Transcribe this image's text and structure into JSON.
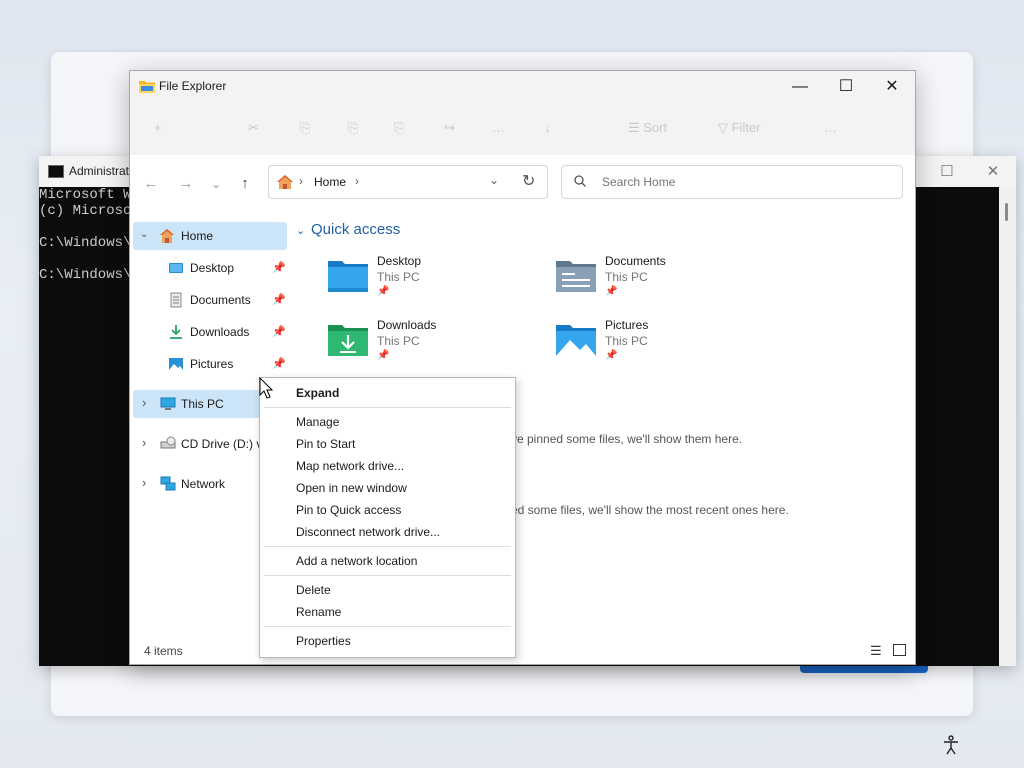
{
  "cmd": {
    "title": "Administrat",
    "lines": [
      "Microsoft Wi",
      "(c) Microso",
      "",
      "C:\\Windows\\S",
      "",
      "C:\\Windows\\S"
    ]
  },
  "explorer": {
    "title": "File Explorer",
    "controls": {
      "minimize": "—",
      "maximize": "☐",
      "close": "✕"
    },
    "toolbar_ghost": [
      "+",
      "✂",
      "⎘",
      "⎘",
      "⎘",
      "↪",
      "…",
      "↓",
      "☰ Sort",
      "▽ Filter",
      "…"
    ],
    "nav": {
      "back": "←",
      "forward": "→",
      "recent": "⌄",
      "up": "↑"
    },
    "address": {
      "path": "Home",
      "separator": "›",
      "dropdown": "⌄",
      "refresh": "↻"
    },
    "search": {
      "placeholder": "Search Home"
    },
    "sidebar": {
      "items": [
        {
          "label": "Home",
          "chevron": "⌄",
          "selected": true
        },
        {
          "label": "Desktop",
          "pinned": true
        },
        {
          "label": "Documents",
          "pinned": true
        },
        {
          "label": "Downloads",
          "pinned": true
        },
        {
          "label": "Pictures",
          "pinned": true
        },
        {
          "label": "This PC",
          "chevron": "›",
          "selected": true
        },
        {
          "label": "CD Drive (D:) v",
          "chevron": "›"
        },
        {
          "label": "Network",
          "chevron": "›"
        }
      ]
    },
    "quick_access": {
      "heading": "Quick access",
      "chevron": "⌄",
      "items": [
        {
          "name": "Desktop",
          "location": "This PC"
        },
        {
          "name": "Documents",
          "location": "This PC"
        },
        {
          "name": "Downloads",
          "location": "This PC"
        },
        {
          "name": "Pictures",
          "location": "This PC"
        }
      ]
    },
    "hints": {
      "favorites": "ve pinned some files, we'll show them here.",
      "recent": "ed some files, we'll show the most recent ones here."
    },
    "status": "4 items"
  },
  "context_menu": {
    "items": [
      "Expand",
      "Manage",
      "Pin to Start",
      "Map network drive...",
      "Open in new window",
      "Pin to Quick access",
      "Disconnect network drive...",
      "Add a network location",
      "Delete",
      "Rename",
      "Properties"
    ]
  },
  "colors": {
    "accent": "#1a6ad3",
    "selection": "#cce4f7",
    "heading": "#1f5fa8"
  }
}
